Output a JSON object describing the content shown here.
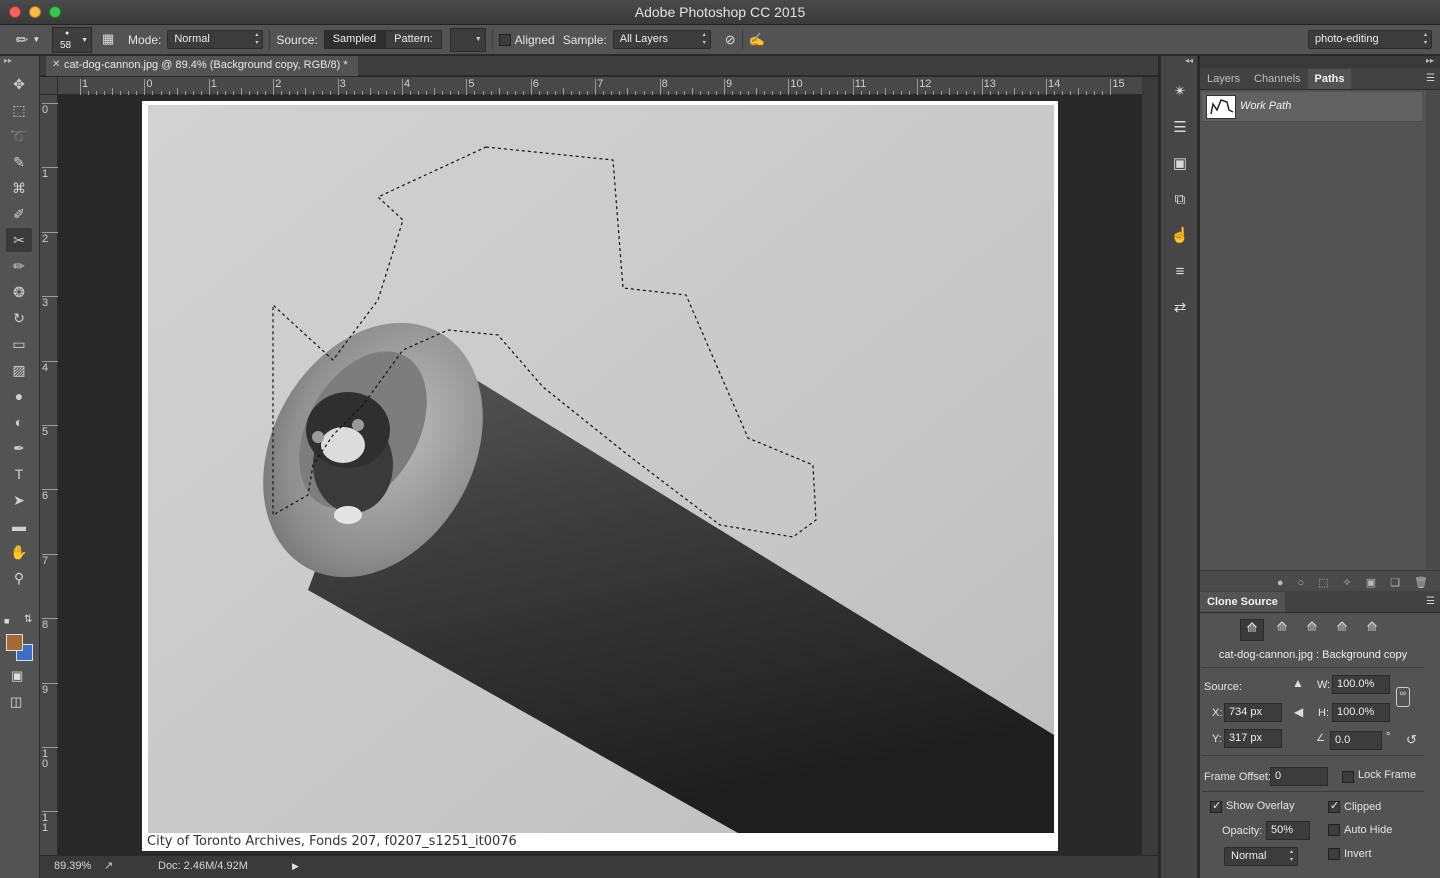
{
  "window": {
    "title": "Adobe Photoshop CC 2015",
    "traffic_colors": [
      "#fc605c",
      "#fdbc40",
      "#34c84a"
    ]
  },
  "options_bar": {
    "brush_size": "58",
    "mode_label": "Mode:",
    "mode_value": "Normal",
    "source_label": "Source:",
    "source_sampled": "Sampled",
    "source_pattern": "Pattern:",
    "aligned_label": "Aligned",
    "aligned_checked": false,
    "sample_label": "Sample:",
    "sample_value": "All Layers",
    "workspace": "photo-editing"
  },
  "document": {
    "tab_title": "cat-dog-cannon.jpg @ 89.4% (Background copy, RGB/8) *",
    "caption": "City of Toronto Archives, Fonds 207, f0207_s1251_it0076",
    "zoom": "89.39%",
    "doc_info": "Doc: 2.46M/4.92M"
  },
  "rulers": {
    "horizontal": [
      "1",
      "0",
      "1",
      "2",
      "3",
      "4",
      "5",
      "6",
      "7",
      "8",
      "9",
      "10",
      "11",
      "12",
      "13",
      "14",
      "15"
    ],
    "vertical": [
      "0",
      "1",
      "2",
      "3",
      "4",
      "5",
      "6",
      "7",
      "8",
      "9",
      "1\n0",
      "1\n1"
    ]
  },
  "tools": [
    {
      "name": "move-tool-icon",
      "glyph": "✥"
    },
    {
      "name": "marquee-tool-icon",
      "glyph": "⬚"
    },
    {
      "name": "lasso-tool-icon",
      "glyph": "➰"
    },
    {
      "name": "quick-selection-tool-icon",
      "glyph": "✎"
    },
    {
      "name": "crop-tool-icon",
      "glyph": "⌘"
    },
    {
      "name": "eyedropper-tool-icon",
      "glyph": "✐"
    },
    {
      "name": "healing-brush-tool-icon",
      "glyph": "✂"
    },
    {
      "name": "brush-tool-icon",
      "glyph": "✏"
    },
    {
      "name": "clone-stamp-tool-icon",
      "glyph": "❂"
    },
    {
      "name": "history-brush-tool-icon",
      "glyph": "↻"
    },
    {
      "name": "eraser-tool-icon",
      "glyph": "▭"
    },
    {
      "name": "gradient-tool-icon",
      "glyph": "▨"
    },
    {
      "name": "blur-tool-icon",
      "glyph": "●"
    },
    {
      "name": "dodge-tool-icon",
      "glyph": "◐"
    },
    {
      "name": "pen-tool-icon",
      "glyph": "✒"
    },
    {
      "name": "type-tool-icon",
      "glyph": "T"
    },
    {
      "name": "path-selection-tool-icon",
      "glyph": "➤"
    },
    {
      "name": "shape-tool-icon",
      "glyph": "▬"
    },
    {
      "name": "hand-tool-icon",
      "glyph": "✋"
    },
    {
      "name": "zoom-tool-icon",
      "glyph": "⚲"
    }
  ],
  "colors": {
    "foreground": "#a56a32",
    "background": "#3a6fc4"
  },
  "panel_strip": [
    {
      "name": "brush-settings-icon",
      "glyph": "✴"
    },
    {
      "name": "brush-presets-icon",
      "glyph": "☰"
    },
    {
      "name": "tool-presets-icon",
      "glyph": "▣"
    },
    {
      "name": "clone-source-icon",
      "glyph": "⧉"
    },
    {
      "name": "actions-icon",
      "glyph": "☝"
    },
    {
      "name": "adjustments-icon",
      "glyph": "≡"
    },
    {
      "name": "history-icon",
      "glyph": "⇄"
    }
  ],
  "layers_panel": {
    "tabs": [
      "Layers",
      "Channels",
      "Paths"
    ],
    "active_tab": "Paths",
    "paths": [
      {
        "label": "Work Path"
      }
    ]
  },
  "clone_source": {
    "title": "Clone Source",
    "source_file": "cat-dog-cannon.jpg : Background copy",
    "source_label": "Source:",
    "x_label": "X:",
    "x_value": "734 px",
    "y_label": "Y:",
    "y_value": "317 px",
    "w_label": "W:",
    "w_value": "100.0%",
    "h_label": "H:",
    "h_value": "100.0%",
    "angle_value": "0.0",
    "angle_unit": "°",
    "frame_offset_label": "Frame Offset:",
    "frame_offset_value": "0",
    "lock_frame_label": "Lock Frame",
    "show_overlay_label": "Show Overlay",
    "clipped_label": "Clipped",
    "opacity_label": "Opacity:",
    "opacity_value": "50%",
    "auto_hide_label": "Auto Hide",
    "blend_mode": "Normal",
    "invert_label": "Invert"
  }
}
